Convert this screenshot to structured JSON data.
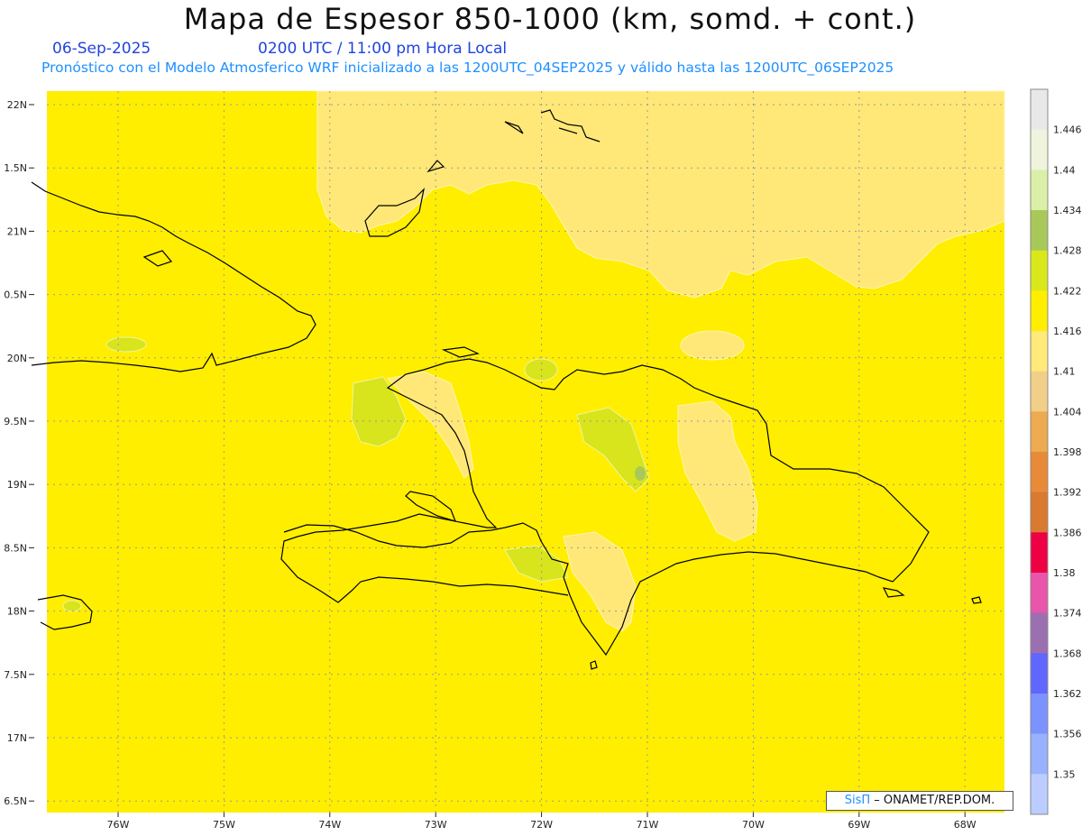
{
  "header": {
    "title": "Mapa de Espesor 850-1000 (km, somd. + cont.)",
    "date": "06-Sep-2025",
    "time": "0200 UTC / 11:00 pm Hora Local",
    "description": "Pronóstico con el Modelo Atmosferico WRF inicializado a las 1200UTC_04SEP2025 y válido hasta las  1200UTC_06SEP2025"
  },
  "map": {
    "lat_labels": [
      "22N",
      "1.5N",
      "21N",
      "0.5N",
      "20N",
      "9.5N",
      "19N",
      "8.5N",
      "18N",
      "7.5N",
      "17N",
      "6.5N"
    ],
    "lon_labels": [
      "76W",
      "75W",
      "74W",
      "73W",
      "72W",
      "71W",
      "70W",
      "69W",
      "68W"
    ]
  },
  "colorbar": {
    "labels": [
      "1.446",
      "1.44",
      "1.434",
      "1.428",
      "1.422",
      "1.416",
      "1.41",
      "1.404",
      "1.398",
      "1.392",
      "1.386",
      "1.38",
      "1.374",
      "1.368",
      "1.362",
      "1.356",
      "1.35"
    ],
    "colors": [
      "#e8e8e8",
      "#eef5dc",
      "#dcefa8",
      "#a9c85a",
      "#d9e81a",
      "#ffee00",
      "#ffea7a",
      "#f2cf88",
      "#eeaa50",
      "#e88a38",
      "#d97a30",
      "#ee0044",
      "#e855aa",
      "#9a70b0",
      "#6066ff",
      "#7c92ff",
      "#99b2ff",
      "#bcccff"
    ]
  },
  "credit": {
    "brand": "SisΠ",
    "text": "– ONAMET/REP.DOM."
  },
  "palette": {
    "field": "#ffee00",
    "light_field": "#ffe878",
    "green_field": "#d8e41c",
    "coast": "#000000",
    "grid": "#999999"
  }
}
